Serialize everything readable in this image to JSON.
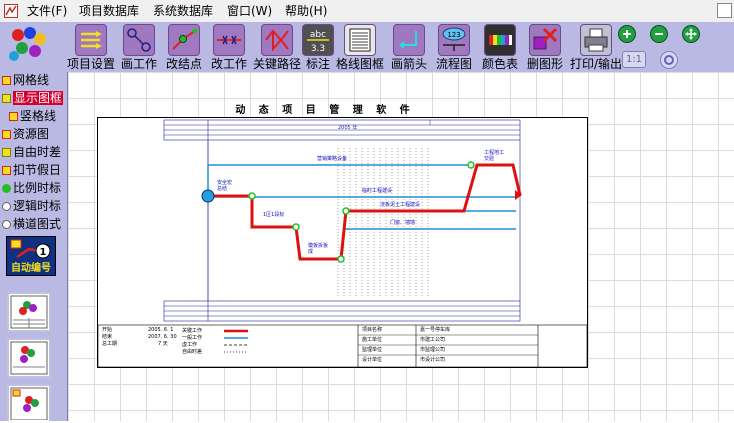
{
  "menu": {
    "items": [
      "文件(F)",
      "项目数据库",
      "系统数据库",
      "窗口(W)",
      "帮助(H)"
    ]
  },
  "toolbar": {
    "buttons": [
      {
        "label": "项目设置",
        "icon": "project-settings-icon"
      },
      {
        "label": "画工作",
        "icon": "draw-task-icon"
      },
      {
        "label": "改结点",
        "icon": "edit-node-icon"
      },
      {
        "label": "改工作",
        "icon": "edit-task-icon"
      },
      {
        "label": "关键路径",
        "icon": "critical-path-icon"
      },
      {
        "label": "标注",
        "icon": "annotation-icon"
      },
      {
        "label": "格线图框",
        "icon": "grid-frame-icon"
      },
      {
        "label": "画箭头",
        "icon": "draw-arrow-icon"
      },
      {
        "label": "流程图",
        "icon": "flowchart-icon"
      },
      {
        "label": "颜色表",
        "icon": "color-table-icon"
      },
      {
        "label": "删图形",
        "icon": "delete-shape-icon"
      },
      {
        "label": "打印/输出",
        "icon": "print-icon"
      }
    ],
    "zoom_label": "1:1"
  },
  "options": [
    {
      "label": "网格线",
      "mark": "checked"
    },
    {
      "label": "显示图框",
      "mark": "selected"
    },
    {
      "label": "竖格线",
      "mark": "checked"
    },
    {
      "label": "资源图",
      "mark": "checked"
    },
    {
      "label": "自由时差",
      "mark": "box"
    },
    {
      "label": "扣节假日",
      "mark": "checked"
    },
    {
      "label": "比例时标",
      "mark": "radio-on"
    },
    {
      "label": "逻辑时标",
      "mark": "radio-off"
    },
    {
      "label": "横道图式",
      "mark": "radio-off"
    }
  ],
  "auto_button": {
    "label": "自动编号",
    "badge": "1"
  },
  "colors": {
    "toolbar_bg": "#b9b9e4",
    "critical": "#e01010",
    "normal": "#2090d0",
    "node": "#20c020",
    "accent": "#d00030"
  },
  "diagram": {
    "title": "动 态 项 目 管 理 软 件",
    "year_label": "2005 年",
    "tasks": [
      {
        "label": "营销策略设备",
        "type": "normal"
      },
      {
        "label": "工程地工交验",
        "type": "critical"
      },
      {
        "label": "安全宏总结",
        "type": "normal"
      },
      {
        "label": "临时工程建设",
        "type": "normal"
      },
      {
        "label": "1区1段标",
        "type": "critical"
      },
      {
        "label": "浇板泥土工程建设",
        "type": "normal"
      },
      {
        "label": "门窗、墙墙",
        "type": "normal"
      },
      {
        "label": "模板拆板成",
        "type": "critical"
      }
    ],
    "info_left": [
      {
        "key": "开始",
        "value": "2005. 6. 1"
      },
      {
        "key": "结束",
        "value": "2007. 6. 30"
      },
      {
        "key": "总工期",
        "value": "7 天"
      }
    ],
    "legend": [
      {
        "label": "关键工作",
        "style": "critical"
      },
      {
        "label": "一般工作",
        "style": "normal"
      },
      {
        "label": "虚工作",
        "style": "dummy"
      },
      {
        "label": "自由时差",
        "style": "float"
      }
    ],
    "info_right": [
      {
        "key": "项目名称",
        "value": "嘉一号停车库"
      },
      {
        "key": "施工单位",
        "value": "市建工公司"
      },
      {
        "key": "监理单位",
        "value": "市监理公司"
      },
      {
        "key": "设计单位",
        "value": "市设计公司"
      }
    ]
  }
}
